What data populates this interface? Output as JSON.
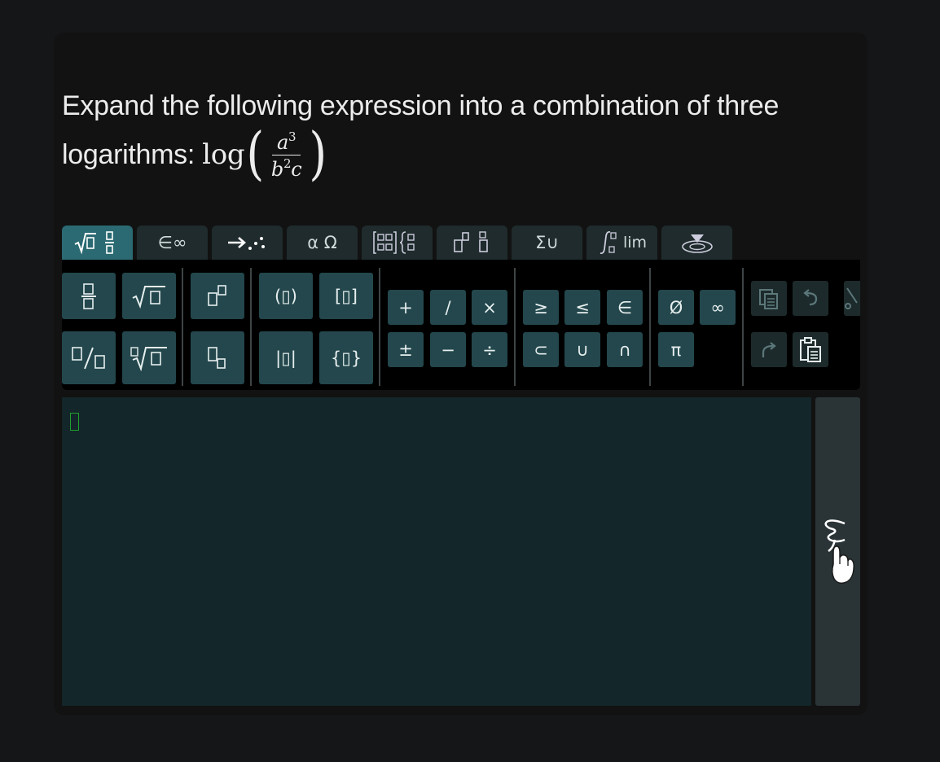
{
  "question": {
    "text": "Expand the following expression into a combination of three logarithms:",
    "math": {
      "fn": "log",
      "open_paren": "(",
      "close_paren": ")",
      "numerator": "a",
      "numerator_exp": "3",
      "denominator_b": "b",
      "denominator_b_exp": "2",
      "denominator_c": "c"
    }
  },
  "tabs": [
    {
      "label": "√▯ ▯/▯",
      "active": true
    },
    {
      "label": "∈∞"
    },
    {
      "label": "→⋰"
    },
    {
      "label": "α Ω"
    },
    {
      "label": "matrix-braces"
    },
    {
      "label": "▯▯"
    },
    {
      "label": "Σ∪"
    },
    {
      "label": "∫ lim"
    },
    {
      "label": "keyboard-toggle"
    }
  ],
  "toolbar": {
    "fraction": "▯/▯",
    "sqrt": "√▯",
    "superscript": "▯▯",
    "parens": "(▯)",
    "brackets": "[▯]",
    "inline_fraction": "▯/▯",
    "nth_root": "∜▯",
    "subscript": "▯▯",
    "abs": "|▯|",
    "braces": "{▯}",
    "plus": "+",
    "slash": "/",
    "times": "×",
    "plusminus": "±",
    "minus": "−",
    "divide": "÷",
    "geq": "≥",
    "leq": "≤",
    "elementof": "∈",
    "subset": "⊂",
    "union": "∪",
    "intersection": "∩",
    "emptyset": "Ø",
    "infinity": "∞",
    "pi": "π",
    "tab_lim_label": "lim"
  },
  "editor": {
    "value": ""
  },
  "colors": {
    "active_tab": "#2b6a72",
    "button": "#23474c",
    "editor_bg": "#132629",
    "cursor": "#1fa12e"
  }
}
